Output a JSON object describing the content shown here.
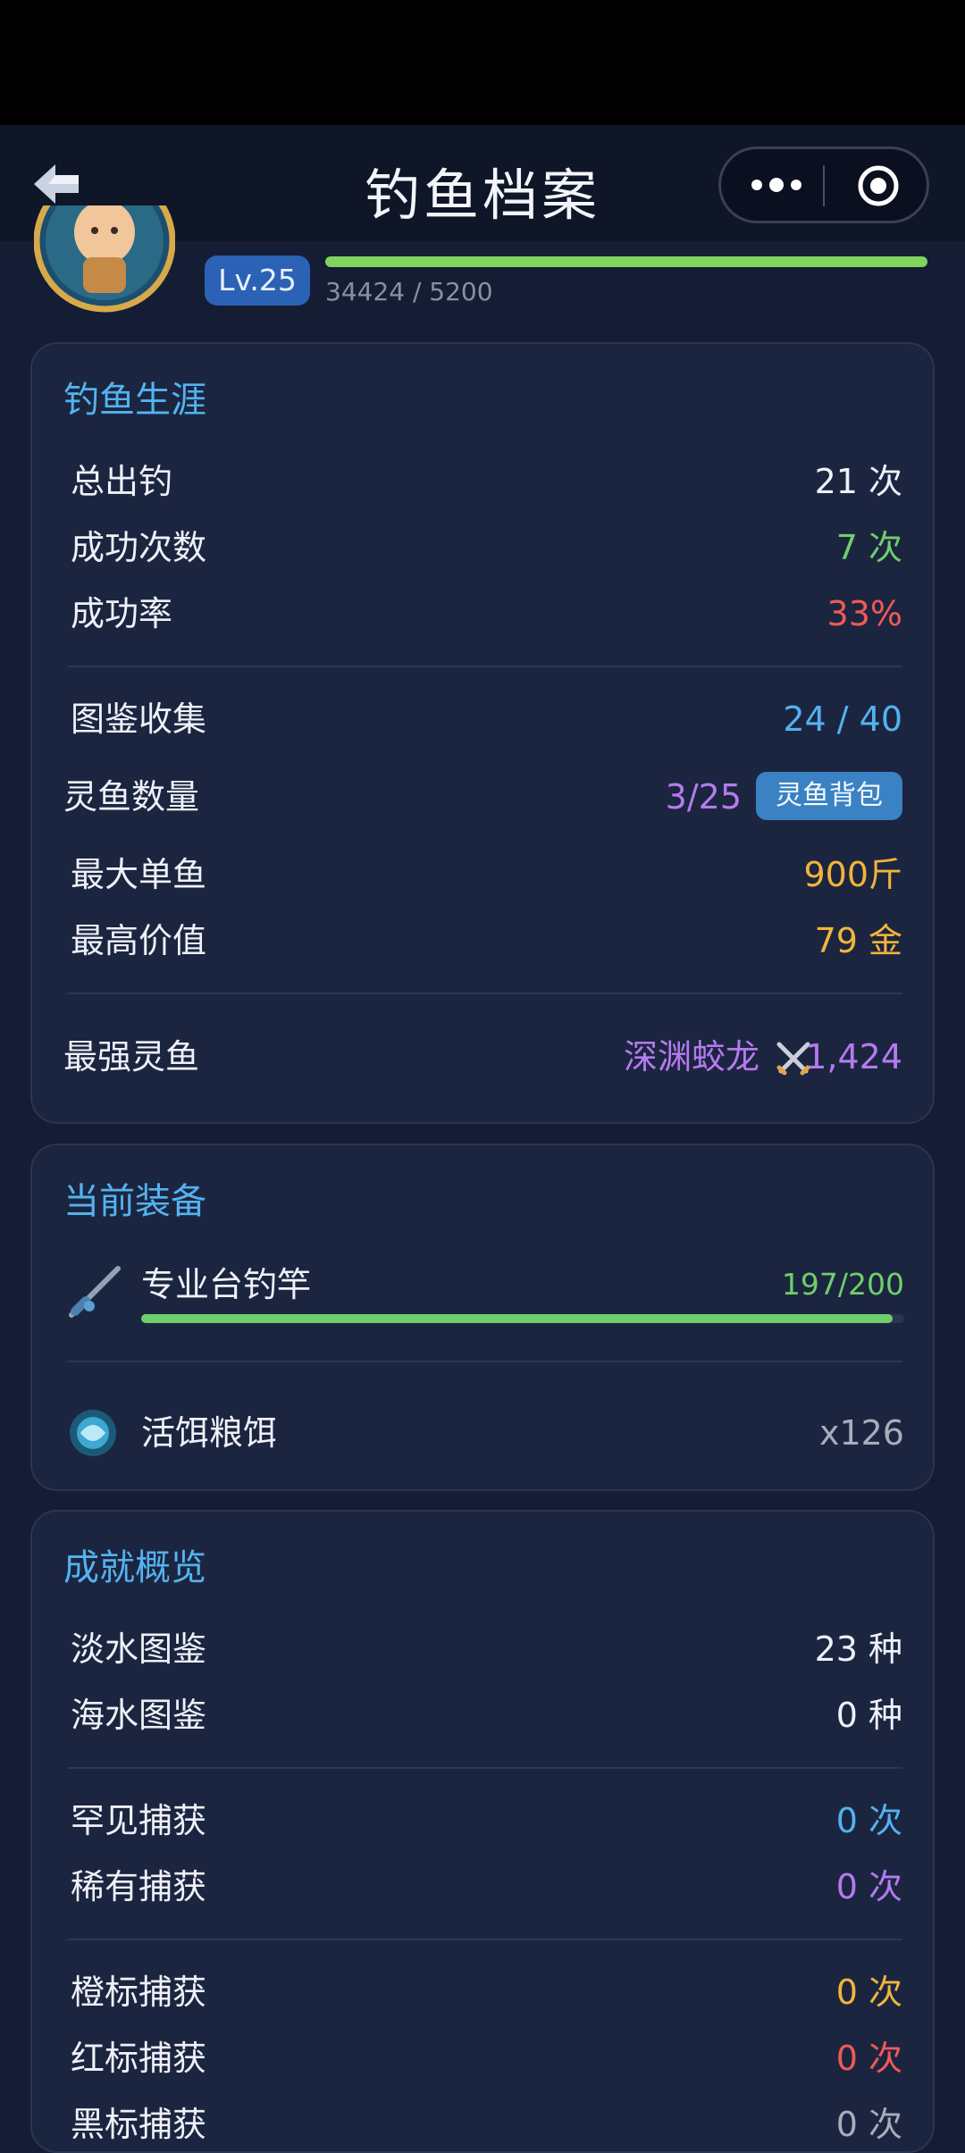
{
  "nav": {
    "title": "钓鱼档案"
  },
  "profile": {
    "level": "Lv.25",
    "xp_text": "34424 / 5200",
    "xp_progress": 1.0
  },
  "career": {
    "title": "钓鱼生涯",
    "total_label": "总出钓",
    "total_value": "21 次",
    "success_label": "成功次数",
    "success_value": "7 次",
    "rate_label": "成功率",
    "rate_value": "33%",
    "collection_label": "图鉴收集",
    "collection_value": "24 / 40",
    "spirit_label": "灵鱼数量",
    "spirit_value": "3/25",
    "spirit_button": "灵鱼背包",
    "biggest_label": "最大单鱼",
    "biggest_value": "900斤",
    "highest_label": "最高价值",
    "highest_value": "79 金",
    "strongest_label": "最强灵鱼",
    "strongest_name": "深渊蛟龙",
    "strongest_power": "1,424"
  },
  "equipment": {
    "title": "当前装备",
    "rod_name": "专业台钓竿",
    "rod_durability": "197/200",
    "rod_progress": 0.985,
    "bait_name": "活饵粮饵",
    "bait_count": "x126"
  },
  "achievements": {
    "title": "成就概览",
    "fresh_label": "淡水图鉴",
    "fresh_value": "23 种",
    "sea_label": "海水图鉴",
    "sea_value": "0 种",
    "rare1_label": "罕见捕获",
    "rare1_value": "0 次",
    "rare2_label": "稀有捕获",
    "rare2_value": "0 次",
    "orange_label": "橙标捕获",
    "orange_value": "0 次",
    "red_label": "红标捕获",
    "red_value": "0 次",
    "black_label": "黑标捕获",
    "black_value": "0 次"
  },
  "colors": {
    "accent": "#52b3f0",
    "success": "#6fcf6b",
    "danger": "#ef5a56",
    "epic": "#b57aef",
    "gold": "#f1b53b"
  }
}
